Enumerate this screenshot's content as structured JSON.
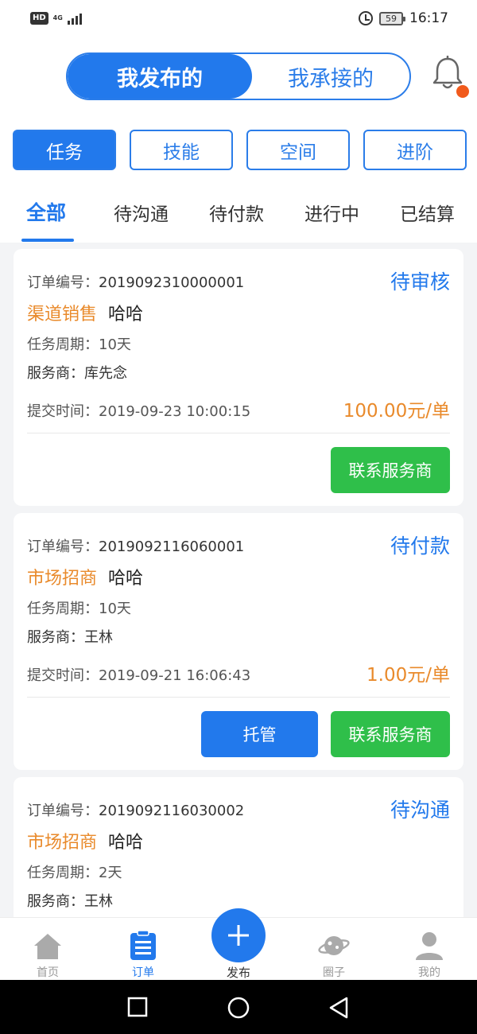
{
  "status_bar": {
    "hd": "HD",
    "network": "4G",
    "battery": "59",
    "time": "16:17"
  },
  "header": {
    "segment": {
      "active": "我发布的",
      "inactive": "我承接的"
    },
    "has_notification": true
  },
  "categories": [
    "任务",
    "技能",
    "空间",
    "进阶"
  ],
  "status_tabs": [
    "全部",
    "待沟通",
    "待付款",
    "进行中",
    "已结算"
  ],
  "orders": [
    {
      "order_no_label": "订单编号：",
      "order_no": "2019092310000001",
      "status": "待审核",
      "type": "渠道销售",
      "name": "哈哈",
      "period": "任务周期：10天",
      "provider": "服务商：库先念",
      "submit_time": "提交时间：2019-09-23 10:00:15",
      "price": "100.00元/单",
      "buttons": [
        "联系服务商"
      ]
    },
    {
      "order_no_label": "订单编号：",
      "order_no": "2019092116060001",
      "status": "待付款",
      "type": "市场招商",
      "name": "哈哈",
      "period": "任务周期：10天",
      "provider": "服务商：王林",
      "submit_time": "提交时间：2019-09-21 16:06:43",
      "price": "1.00元/单",
      "buttons": [
        "托管",
        "联系服务商"
      ]
    },
    {
      "order_no_label": "订单编号：",
      "order_no": "2019092116030002",
      "status": "待沟通",
      "type": "市场招商",
      "name": "哈哈",
      "period": "任务周期：2天",
      "provider": "服务商：王林"
    }
  ],
  "bottom_nav": {
    "home": "首页",
    "orders": "订单",
    "publish": "发布",
    "circle": "圈子",
    "mine": "我的"
  },
  "colors": {
    "primary": "#2279ec",
    "orange": "#e98a2b",
    "green": "#2fbf4a",
    "notification": "#f15a1c"
  }
}
